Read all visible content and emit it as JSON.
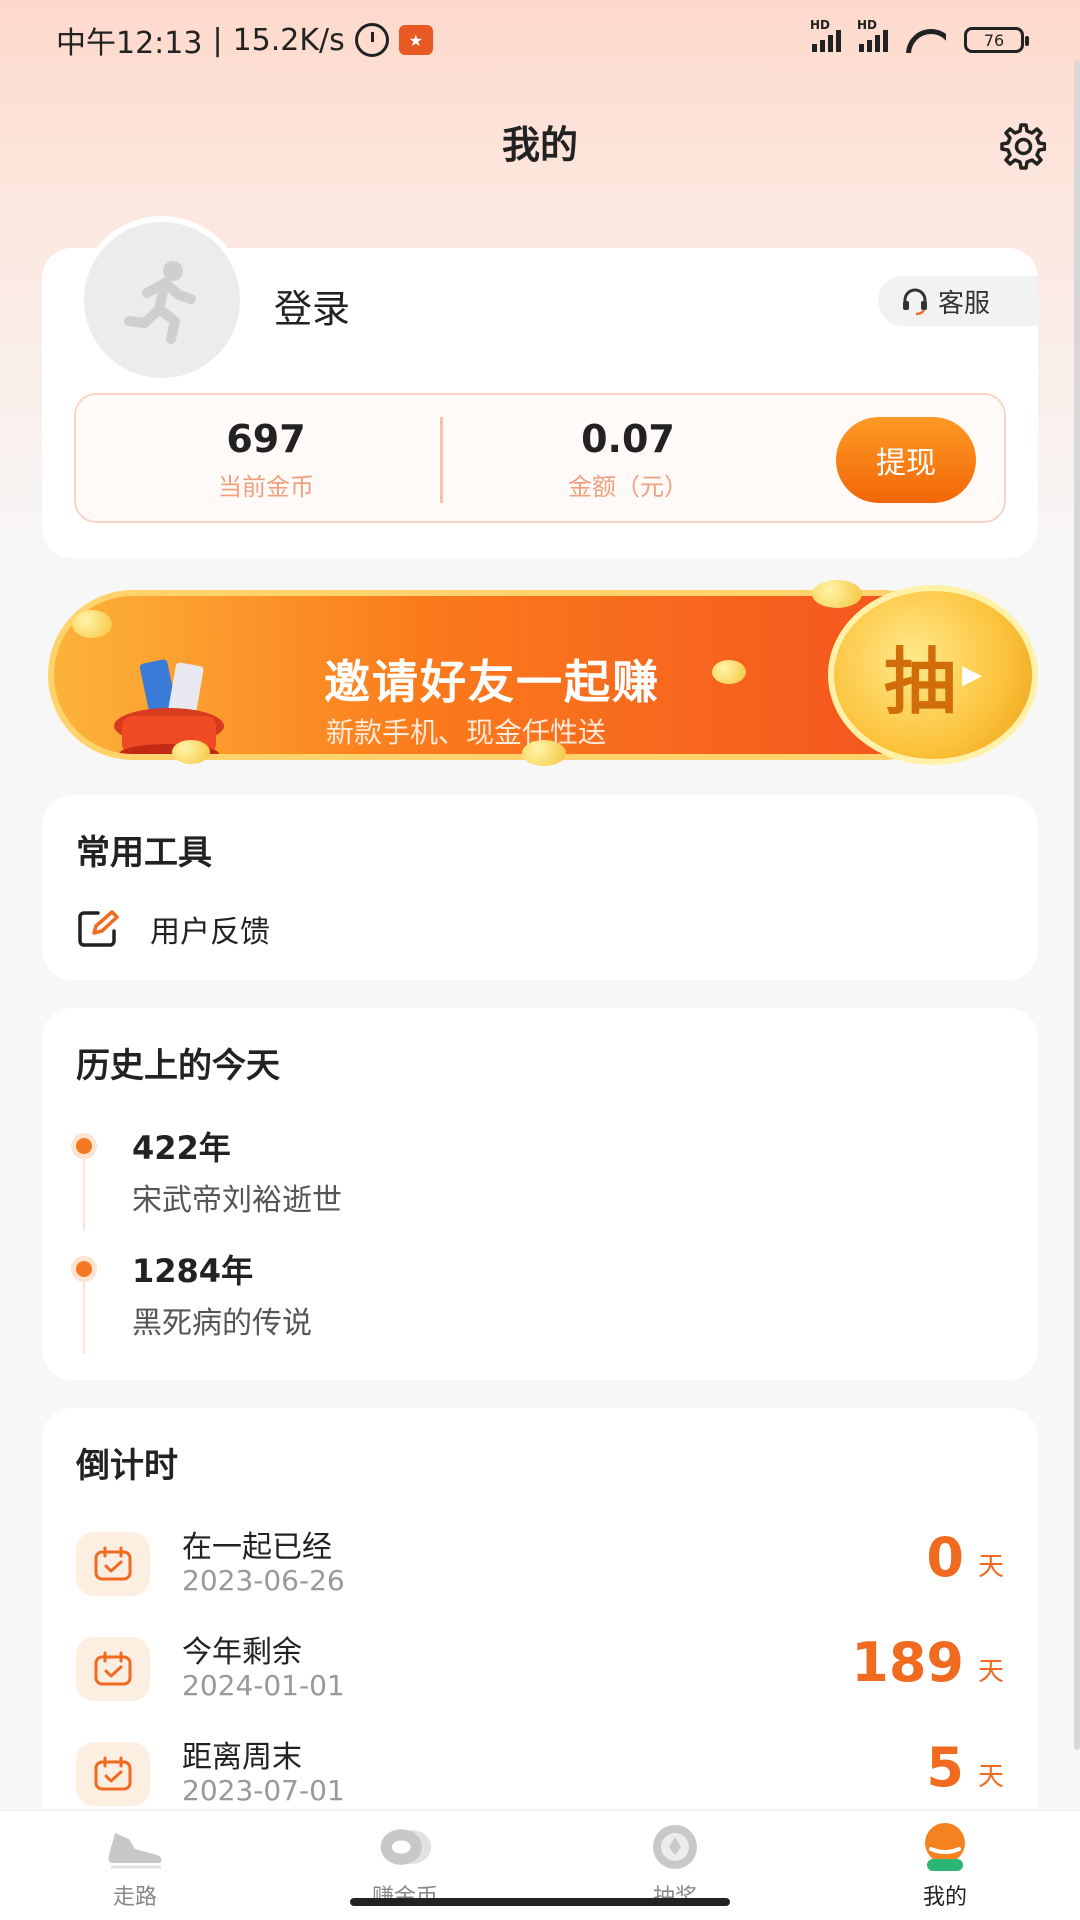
{
  "status_bar": {
    "time": "中午12:13",
    "speed": "15.2K/s",
    "hd1": "HD",
    "hd2": "HD",
    "battery": "76"
  },
  "header": {
    "title": "我的"
  },
  "profile": {
    "login_label": "登录",
    "service_label": "客服",
    "coins_value": "697",
    "coins_label": "当前金币",
    "amount_value": "0.07",
    "amount_label": "金额（元）",
    "withdraw_label": "提现"
  },
  "banner": {
    "title": "邀请好友一起赚",
    "subtitle": "新款手机、现金任性送",
    "draw_label": "抽"
  },
  "tools": {
    "title": "常用工具",
    "items": [
      {
        "label": "用户反馈",
        "icon": "edit-icon"
      }
    ]
  },
  "history": {
    "title": "历史上的今天",
    "items": [
      {
        "year": "422年",
        "event": "宋武帝刘裕逝世"
      },
      {
        "year": "1284年",
        "event": "黑死病的传说"
      }
    ]
  },
  "countdown": {
    "title": "倒计时",
    "items": [
      {
        "name": "在一起已经",
        "date": "2023-06-26",
        "value": "0",
        "unit": "天"
      },
      {
        "name": "今年剩余",
        "date": "2024-01-01",
        "value": "189",
        "unit": "天"
      },
      {
        "name": "距离周末",
        "date": "2023-07-01",
        "value": "5",
        "unit": "天"
      }
    ]
  },
  "bottom_nav": {
    "items": [
      {
        "label": "走路",
        "icon": "shoe-icon"
      },
      {
        "label": "赚金币",
        "icon": "coin-icon"
      },
      {
        "label": "抽奖",
        "icon": "lottery-icon"
      },
      {
        "label": "我的",
        "icon": "profile-icon"
      }
    ],
    "active_index": 3
  },
  "colors": {
    "accent": "#f06a1f",
    "withdraw_button": "#f26708",
    "header_gradient": "#fdd9cb"
  }
}
